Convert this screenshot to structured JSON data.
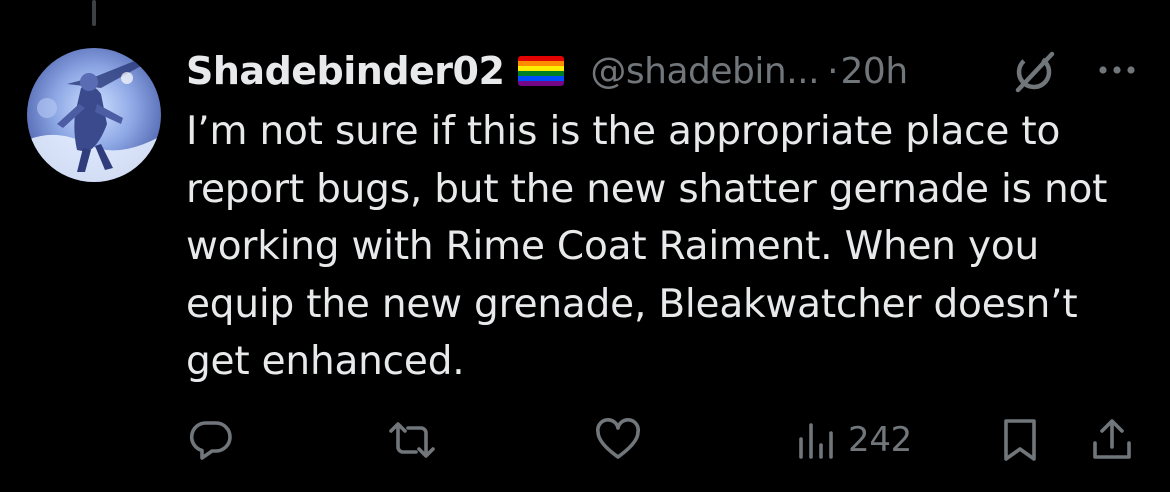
{
  "tweet": {
    "display_name": "Shadebinder02",
    "handle": "@shadebin...",
    "separator": "·",
    "time": "20h",
    "flag_icon": "rainbow-flag-icon",
    "text": "I’m not sure if this is the appropriate place to report bugs, but the new shatter gernade is not working with Rime Coat Raiment. When you equip the new grenade, Bleakwatcher doesn’t get enhanced."
  },
  "header_icons": [
    "grok-icon",
    "more-options-icon"
  ],
  "actions": {
    "reply_icon": "reply-icon",
    "repost_icon": "repost-icon",
    "like_icon": "like-heart-icon",
    "views_icon": "views-bar-chart-icon",
    "views_count": "242",
    "bookmark_icon": "bookmark-icon",
    "share_icon": "share-icon"
  },
  "colors": {
    "background": "#000000",
    "primary_text": "#e7e9ea",
    "secondary_text": "#71767b",
    "thread_line": "#3e4144"
  }
}
